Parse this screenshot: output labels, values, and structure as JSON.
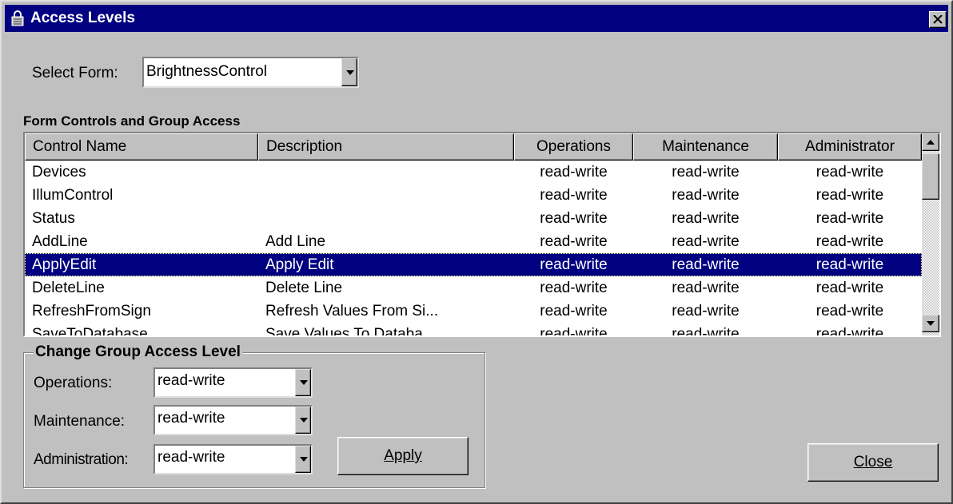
{
  "window": {
    "title": "Access Levels"
  },
  "select_form": {
    "label": "Select Form:",
    "value": "BrightnessControl"
  },
  "grid": {
    "caption": "Form Controls and Group Access",
    "columns": [
      "Control Name",
      "Description",
      "Operations",
      "Maintenance",
      "Administrator"
    ],
    "selected_row": 4,
    "rows": [
      {
        "name": "Devices",
        "description": "",
        "operations": "read-write",
        "maintenance": "read-write",
        "administrator": "read-write"
      },
      {
        "name": "IllumControl",
        "description": "",
        "operations": "read-write",
        "maintenance": "read-write",
        "administrator": "read-write"
      },
      {
        "name": "Status",
        "description": "",
        "operations": "read-write",
        "maintenance": "read-write",
        "administrator": "read-write"
      },
      {
        "name": "AddLine",
        "description": "Add Line",
        "operations": "read-write",
        "maintenance": "read-write",
        "administrator": "read-write"
      },
      {
        "name": "ApplyEdit",
        "description": "Apply Edit",
        "operations": "read-write",
        "maintenance": "read-write",
        "administrator": "read-write"
      },
      {
        "name": "DeleteLine",
        "description": "Delete Line",
        "operations": "read-write",
        "maintenance": "read-write",
        "administrator": "read-write"
      },
      {
        "name": "RefreshFromSign",
        "description": "Refresh Values From Si...",
        "operations": "read-write",
        "maintenance": "read-write",
        "administrator": "read-write"
      },
      {
        "name": "SaveToDatabase",
        "description": "Save Values To Databa...",
        "operations": "read-write",
        "maintenance": "read-write",
        "administrator": "read-write"
      }
    ]
  },
  "change_group": {
    "caption": "Change Group Access Level",
    "operations": {
      "label": "Operations:",
      "value": "read-write"
    },
    "maintenance": {
      "label": "Maintenance:",
      "value": "read-write"
    },
    "administration": {
      "label": "Administration:",
      "value": "read-write"
    },
    "apply_label": "Apply"
  },
  "close_label": "Close",
  "colors": {
    "title_bar": "#000080",
    "face": "#c0c0c0",
    "selection": "#000080"
  },
  "icons": {
    "title": "lock-icon",
    "close": "close-x-icon"
  }
}
